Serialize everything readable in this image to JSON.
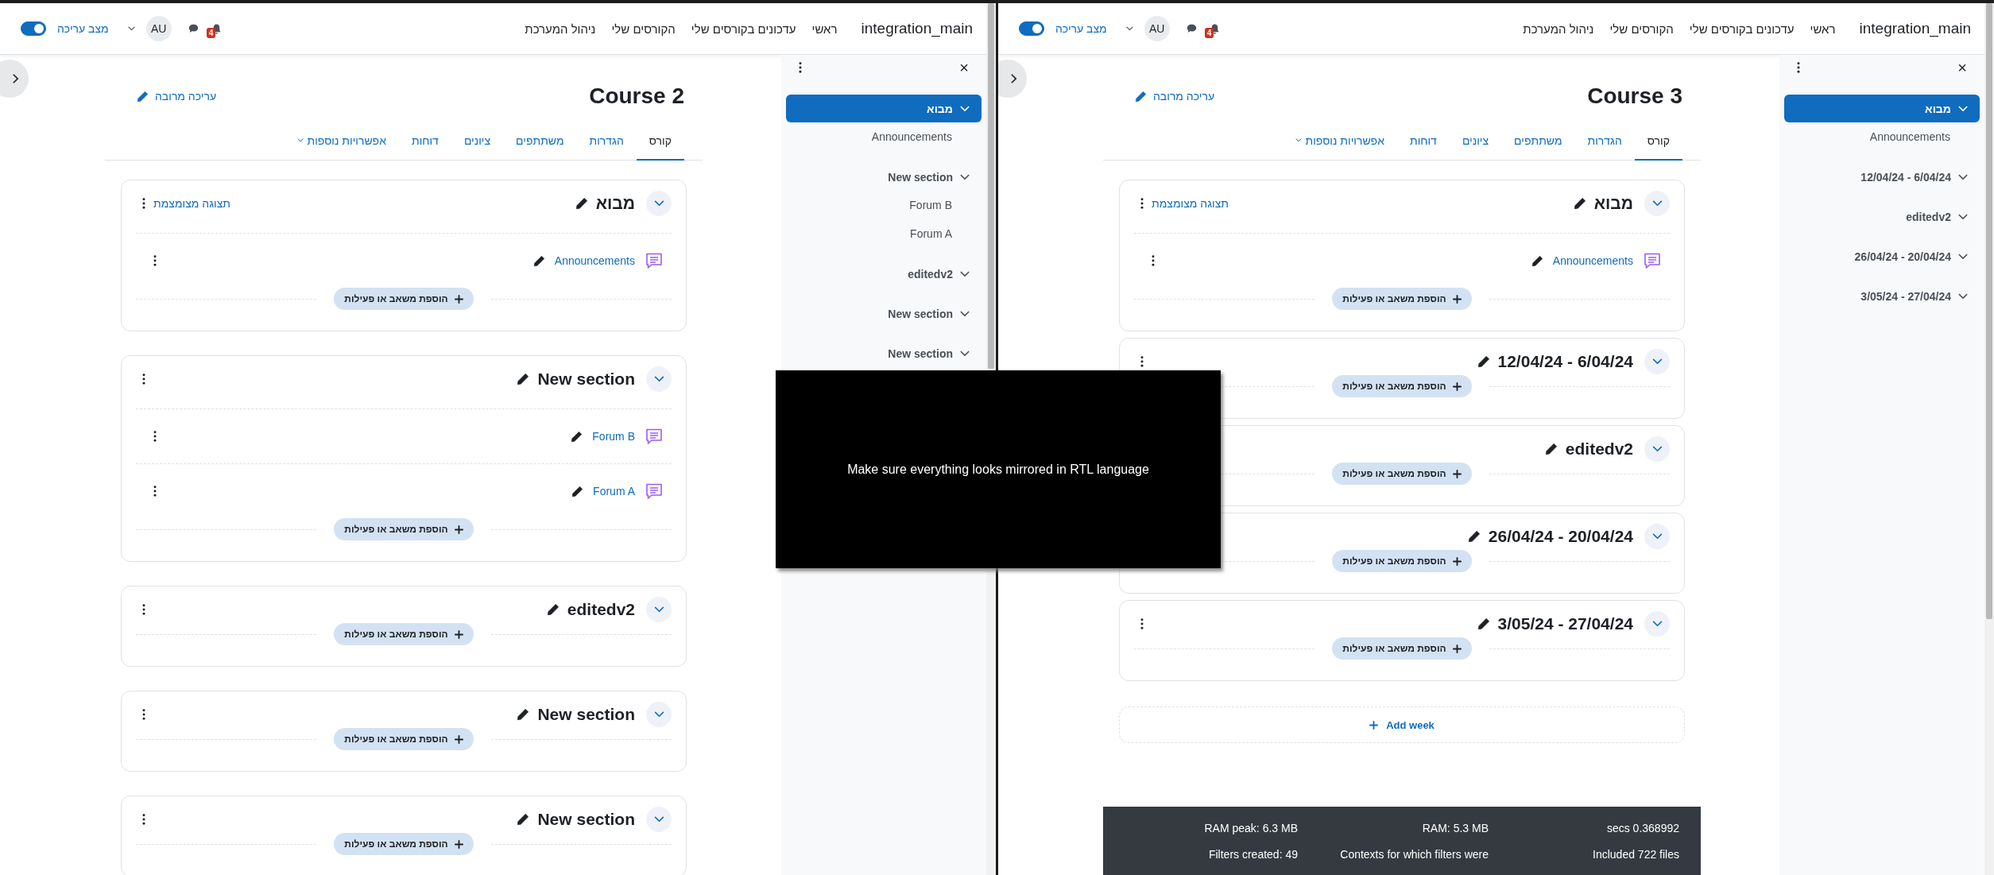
{
  "windows": [
    {
      "navbar": {
        "brand": "integration_main",
        "links": [
          {
            "label": "ראשי"
          },
          {
            "label": "עדכונים בקורסים שלי"
          },
          {
            "label": "הקורסים שלי"
          },
          {
            "label": "ניהול המערכת"
          }
        ],
        "notification_count": "4",
        "avatar": "AU",
        "edit_mode": {
          "label": "מצב עריכה",
          "on": true
        }
      },
      "close_label": "×",
      "course_index": [
        {
          "title": "מבוא",
          "selected": true,
          "children": [
            {
              "title": "Announcements"
            }
          ]
        },
        {
          "title": "12/04/24 - 6/04/24",
          "selected": false
        },
        {
          "title": "editedv2",
          "selected": false
        },
        {
          "title": "26/04/24 - 20/04/24",
          "selected": false
        },
        {
          "title": "3/05/24 - 27/04/24",
          "selected": false
        }
      ],
      "course_title": "Course 3",
      "bulk_edit": "עריכה מרובה",
      "tabs": [
        {
          "label": "קורס",
          "selected": true,
          "kind": "link"
        },
        {
          "label": "הגדרות",
          "selected": false,
          "kind": "link"
        },
        {
          "label": "משתתפים",
          "selected": false,
          "kind": "link"
        },
        {
          "label": "ציונים",
          "selected": false,
          "kind": "link"
        },
        {
          "label": "דוחות",
          "selected": false,
          "kind": "link"
        },
        {
          "label": "אפשרויות נוספות",
          "selected": false,
          "kind": "menu"
        }
      ],
      "sections": [
        {
          "title": "מבוא",
          "collapse_all": "תצוגה מצומצמת",
          "activities": [
            {
              "name": "Announcements"
            }
          ],
          "add_label": "הוספת משאב או פעילות"
        },
        {
          "title": "12/04/24 - 6/04/24",
          "add_label": "הוספת משאב או פעילות"
        },
        {
          "title": "editedv2",
          "add_label": "הוספת משאב או פעילות"
        },
        {
          "title": "26/04/24 - 20/04/24",
          "add_label": "הוספת משאב או פעילות"
        },
        {
          "title": "3/05/24 - 27/04/24",
          "add_label": "הוספת משאב או פעילות"
        }
      ],
      "add_week": "Add week",
      "footer": [
        {
          "cells": [
            "secs 0.368992",
            "RAM: 5.3 MB",
            "RAM peak: 6.3 MB"
          ]
        },
        {
          "cells": [
            "Included 722 files",
            "Contexts for which filters were",
            "Filters created: 49"
          ]
        }
      ]
    },
    {
      "navbar": {
        "brand": "integration_main",
        "links": [
          {
            "label": "ראשי"
          },
          {
            "label": "עדכונים בקורסים שלי"
          },
          {
            "label": "הקורסים שלי"
          },
          {
            "label": "ניהול המערכת"
          }
        ],
        "notification_count": "4",
        "avatar": "AU",
        "edit_mode": {
          "label": "מצב עריכה",
          "on": true
        }
      },
      "close_label": "×",
      "course_index": [
        {
          "title": "מבוא",
          "selected": true,
          "children": [
            {
              "title": "Announcements"
            }
          ]
        },
        {
          "title": "New section",
          "selected": false,
          "children": [
            {
              "title": "Forum B"
            },
            {
              "title": "Forum A"
            }
          ]
        },
        {
          "title": "editedv2",
          "selected": false
        },
        {
          "title": "New section",
          "selected": false
        },
        {
          "title": "New section",
          "selected": false
        }
      ],
      "course_title": "Course 2",
      "bulk_edit": "עריכה מרובה",
      "tabs": [
        {
          "label": "קורס",
          "selected": true,
          "kind": "link"
        },
        {
          "label": "הגדרות",
          "selected": false,
          "kind": "link"
        },
        {
          "label": "משתתפים",
          "selected": false,
          "kind": "link"
        },
        {
          "label": "ציונים",
          "selected": false,
          "kind": "link"
        },
        {
          "label": "דוחות",
          "selected": false,
          "kind": "link"
        },
        {
          "label": "אפשרויות נוספות",
          "selected": false,
          "kind": "menu"
        }
      ],
      "sections": [
        {
          "title": "מבוא",
          "collapse_all": "תצוגה מצומצמת",
          "activities": [
            {
              "name": "Announcements"
            }
          ],
          "add_label": "הוספת משאב או פעילות"
        },
        {
          "title": "New section",
          "activities": [
            {
              "name": "Forum B"
            },
            {
              "name": "Forum A"
            }
          ],
          "add_label": "הוספת משאב או פעילות"
        },
        {
          "title": "editedv2",
          "add_label": "הוספת משאב או פעילות"
        },
        {
          "title": "New section",
          "add_label": "הוספת משאב או פעילות"
        },
        {
          "title": "New section",
          "add_label": "הוספת משאב או פעילות"
        }
      ]
    }
  ],
  "overlay_message": "Make sure everything looks mirrored in RTL language"
}
